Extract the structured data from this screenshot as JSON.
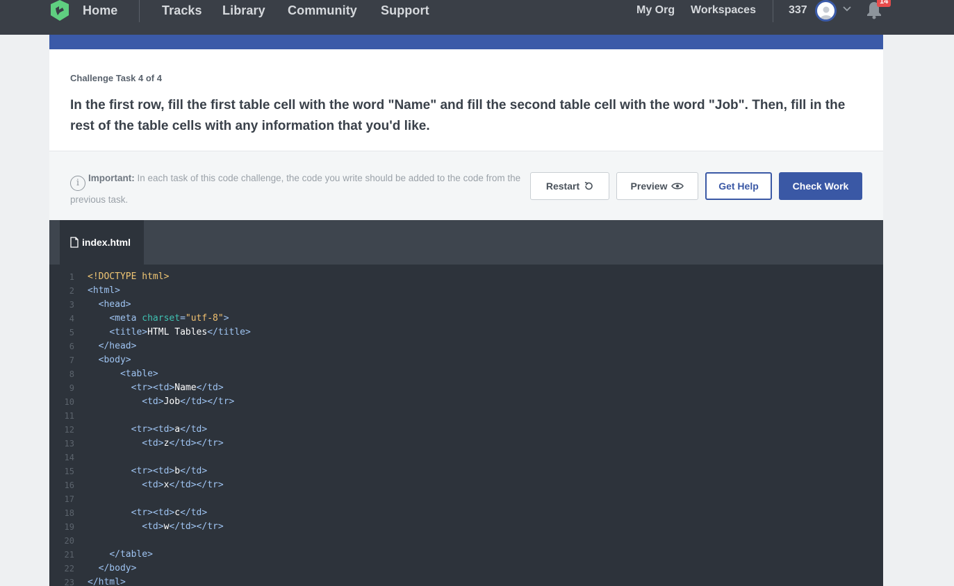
{
  "nav": {
    "home": "Home",
    "tracks": "Tracks",
    "library": "Library",
    "community": "Community",
    "support": "Support",
    "my_org": "My Org",
    "workspaces": "Workspaces",
    "points": "337",
    "notifications": "14"
  },
  "colors": {
    "nav_bg": "#3a3f47",
    "accent_blue": "#3a58a5",
    "editor_bg": "#2d333b",
    "badge_red": "#e84c4c"
  },
  "task": {
    "label": "Challenge Task 4 of 4",
    "text": "In the first row, fill the first table cell with the word \"Name\" and fill the second table cell with the word \"Job\". Then, fill in the rest of the table cells with any information that you'd like."
  },
  "notice": {
    "label": "Important:",
    "text": " In each task of this code challenge, the code you write should be added to the code from the previous task."
  },
  "buttons": {
    "restart": "Restart",
    "preview": "Preview",
    "help": "Get Help",
    "check": "Check Work"
  },
  "editor": {
    "filename": "index.html",
    "lines": [
      [
        [
          "doctype",
          "<!DOCTYPE html>"
        ]
      ],
      [
        [
          "tag",
          "<html>"
        ]
      ],
      [
        [
          "",
          "  "
        ],
        [
          "tag",
          "<head>"
        ]
      ],
      [
        [
          "",
          "    "
        ],
        [
          "tag",
          "<meta "
        ],
        [
          "attr",
          "charset"
        ],
        [
          "tag",
          "="
        ],
        [
          "str",
          "\"utf-8\""
        ],
        [
          "tag",
          ">"
        ]
      ],
      [
        [
          "",
          "    "
        ],
        [
          "tag",
          "<title>"
        ],
        [
          "text",
          "HTML Tables"
        ],
        [
          "tag",
          "</title>"
        ]
      ],
      [
        [
          "",
          "  "
        ],
        [
          "tag",
          "</head>"
        ]
      ],
      [
        [
          "",
          "  "
        ],
        [
          "tag",
          "<body>"
        ]
      ],
      [
        [
          "",
          "      "
        ],
        [
          "tag",
          "<table>"
        ]
      ],
      [
        [
          "",
          "        "
        ],
        [
          "tag",
          "<tr><td>"
        ],
        [
          "text",
          "Name"
        ],
        [
          "tag",
          "</td>"
        ]
      ],
      [
        [
          "",
          "          "
        ],
        [
          "tag",
          "<td>"
        ],
        [
          "text",
          "Job"
        ],
        [
          "tag",
          "</td></tr>"
        ]
      ],
      [],
      [
        [
          "",
          "        "
        ],
        [
          "tag",
          "<tr><td>"
        ],
        [
          "text",
          "a"
        ],
        [
          "tag",
          "</td>"
        ]
      ],
      [
        [
          "",
          "          "
        ],
        [
          "tag",
          "<td>"
        ],
        [
          "text",
          "z"
        ],
        [
          "tag",
          "</td></tr>"
        ]
      ],
      [],
      [
        [
          "",
          "        "
        ],
        [
          "tag",
          "<tr><td>"
        ],
        [
          "text",
          "b"
        ],
        [
          "tag",
          "</td>"
        ]
      ],
      [
        [
          "",
          "          "
        ],
        [
          "tag",
          "<td>"
        ],
        [
          "text",
          "x"
        ],
        [
          "tag",
          "</td></tr>"
        ]
      ],
      [],
      [
        [
          "",
          "        "
        ],
        [
          "tag",
          "<tr><td>"
        ],
        [
          "text",
          "c"
        ],
        [
          "tag",
          "</td>"
        ]
      ],
      [
        [
          "",
          "          "
        ],
        [
          "tag",
          "<td>"
        ],
        [
          "text",
          "w"
        ],
        [
          "tag",
          "</td></tr>"
        ]
      ],
      [],
      [
        [
          "",
          "    "
        ],
        [
          "tag",
          "</table>"
        ]
      ],
      [
        [
          "",
          "  "
        ],
        [
          "tag",
          "</body>"
        ]
      ],
      [
        [
          "tag",
          "</html>"
        ]
      ]
    ]
  }
}
